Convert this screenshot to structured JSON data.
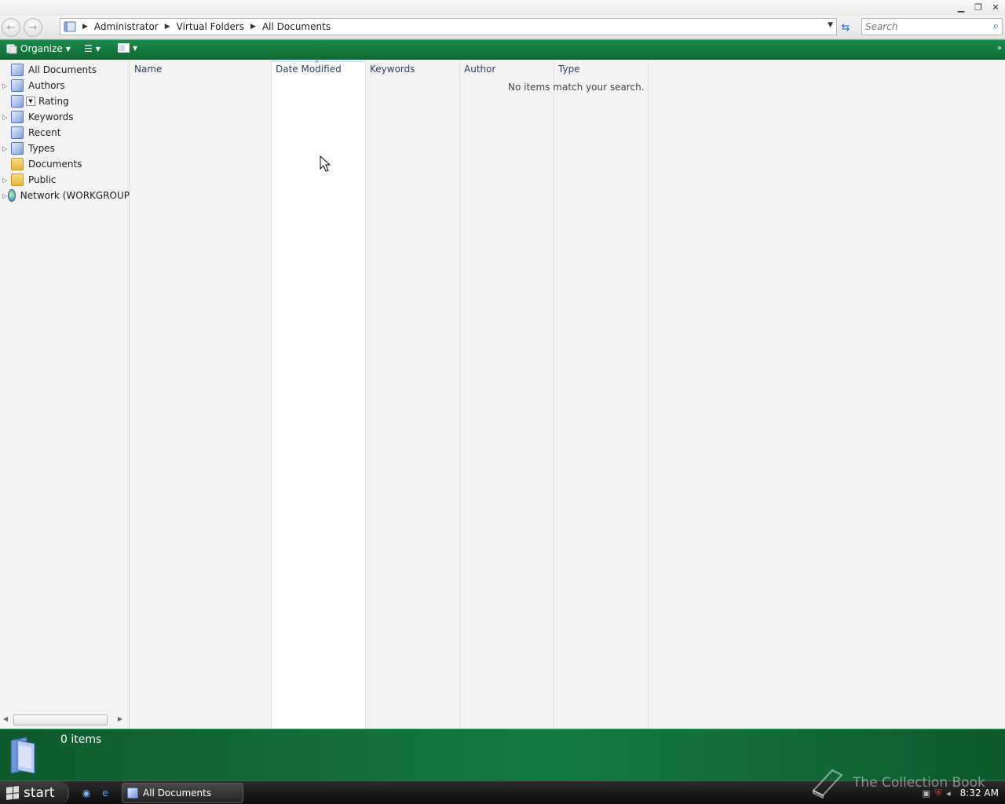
{
  "breadcrumb": [
    "Administrator",
    "Virtual Folders",
    "All Documents"
  ],
  "search": {
    "placeholder": "Search"
  },
  "toolbar": {
    "organize_label": "Organize"
  },
  "tree": {
    "items": [
      {
        "label": "All Documents",
        "icon": "virtual-folder-icon",
        "expandable": false
      },
      {
        "label": "Authors",
        "icon": "virtual-folder-icon",
        "expandable": true
      },
      {
        "label": "Rating",
        "icon": "virtual-folder-icon",
        "expandable": false
      },
      {
        "label": "Keywords",
        "icon": "virtual-folder-icon",
        "expandable": true
      },
      {
        "label": "Recent",
        "icon": "virtual-folder-icon",
        "expandable": false
      },
      {
        "label": "Types",
        "icon": "virtual-folder-icon",
        "expandable": true
      },
      {
        "label": "Documents",
        "icon": "folder-icon",
        "expandable": false
      },
      {
        "label": "Public",
        "icon": "folder-icon",
        "expandable": true
      },
      {
        "label": "Network (WORKGROUP",
        "icon": "network-icon",
        "expandable": true
      }
    ]
  },
  "columns": [
    "Name",
    "Date Modified",
    "Keywords",
    "Author",
    "Type"
  ],
  "empty_message": "No items match your search.",
  "details": {
    "count": "0 items"
  },
  "taskbar": {
    "start_label": "start",
    "task_label": "All Documents",
    "clock": "8:32 AM"
  },
  "watermark": "The Collection Book",
  "colors": {
    "toolbar_green": "#147a42",
    "sorted_column": "#ffffff"
  }
}
